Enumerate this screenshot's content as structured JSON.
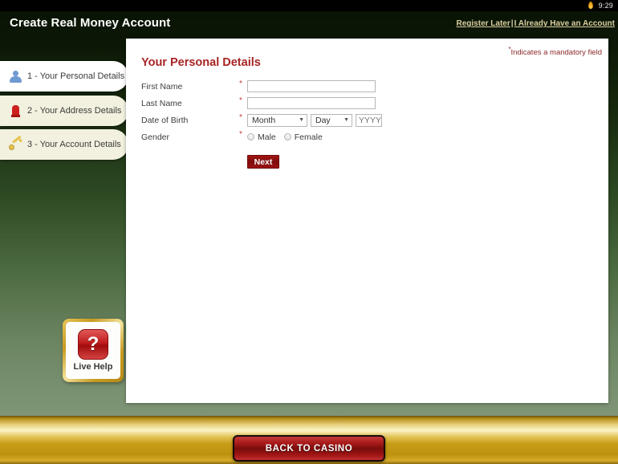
{
  "statusbar": {
    "icon": "flame-icon",
    "time": "9:29"
  },
  "header": {
    "title": "Create Real Money Account",
    "link_register_later": "Register Later",
    "separator": "|",
    "link_already_have_account": "I Already Have an Account"
  },
  "sidebar": {
    "items": [
      {
        "label": "1 - Your Personal Details",
        "icon": "person-icon",
        "active": true
      },
      {
        "label": "2 - Your Address Details",
        "icon": "mailbox-icon",
        "active": false
      },
      {
        "label": "3 - Your Account Details",
        "icon": "key-icon",
        "active": false
      }
    ]
  },
  "panel": {
    "mandatory_star": "*",
    "mandatory_note": "Indicates a mandatory field",
    "section_title": "Your Personal Details",
    "fields": {
      "first_name": {
        "label": "First Name",
        "required_marker": "*",
        "value": "",
        "placeholder": ""
      },
      "last_name": {
        "label": "Last Name",
        "required_marker": "*",
        "value": "",
        "placeholder": ""
      },
      "date_of_birth": {
        "label": "Date of Birth",
        "required_marker": "*",
        "month_selected": "Month",
        "day_selected": "Day",
        "year_placeholder": "YYYY",
        "year_value": "",
        "caret": "▼"
      },
      "gender": {
        "label": "Gender",
        "required_marker": "*",
        "option_male": "Male",
        "option_female": "Female",
        "selected": ""
      }
    },
    "next_button": "Next"
  },
  "live_help": {
    "glyph": "?",
    "label": "Live Help"
  },
  "footer": {
    "back_button": "BACK TO CASINO"
  },
  "colors": {
    "accent_red": "#a82424",
    "header_bg": "#0a1405",
    "gold_bar": "#c79c18",
    "panel_bg": "#ffffff",
    "step_active_bg": "#ffffff",
    "step_inactive_bg": "#f2f1df",
    "link_color": "#d9cfa0"
  }
}
